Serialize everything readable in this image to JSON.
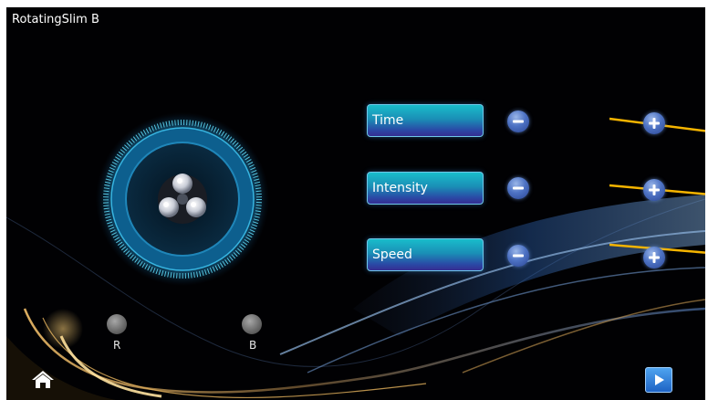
{
  "app": {
    "title": "RotatingSlim B"
  },
  "colors": {
    "background": "#010103",
    "accent_cyan": "#19bccb",
    "button_purple": "#352e92",
    "level_line": "#f5b400",
    "wave_gold": "#d9a441",
    "wave_blue": "#2b5ea8"
  },
  "dial": {
    "icon": "rotating-roller-head-icon"
  },
  "params": [
    {
      "label": "Time",
      "minus_icon": "minus-icon",
      "plus_icon": "plus-icon"
    },
    {
      "label": "Intensity",
      "minus_icon": "minus-icon",
      "plus_icon": "plus-icon"
    },
    {
      "label": "Speed",
      "minus_icon": "minus-icon",
      "plus_icon": "plus-icon"
    }
  ],
  "indicators": [
    {
      "label": "R"
    },
    {
      "label": "B"
    }
  ],
  "nav": {
    "home_icon": "home-icon",
    "start_icon": "play-icon"
  }
}
